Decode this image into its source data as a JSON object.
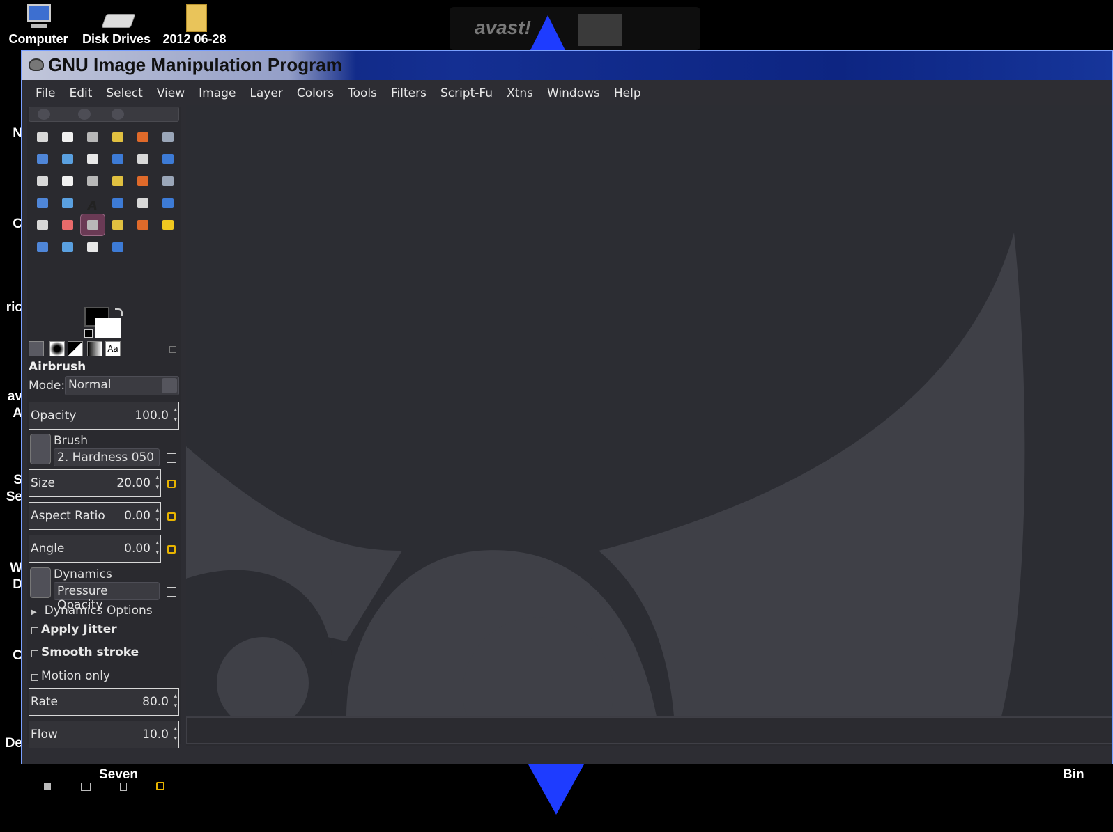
{
  "desktop": {
    "icons": [
      {
        "label": "Computer",
        "icon": "computer-icon"
      },
      {
        "label": "Disk Drives",
        "icon": "disk-drives-icon"
      },
      {
        "label": "2012 06-28",
        "icon": "folder-icon"
      }
    ],
    "bottom_labels": {
      "left": "Seven",
      "right": "Bin"
    },
    "left_clipped": [
      "N",
      "C",
      "ric",
      "av",
      "A",
      "S",
      "Se",
      "W",
      "D",
      "C",
      "De"
    ],
    "avast_text": "avast!"
  },
  "window": {
    "title": "GNU Image Manipulation Program",
    "menu": [
      "File",
      "Edit",
      "Select",
      "View",
      "Image",
      "Layer",
      "Colors",
      "Tools",
      "Filters",
      "Script-Fu",
      "Xtns",
      "Windows",
      "Help"
    ]
  },
  "toolbox": {
    "tools": [
      "rect-select-icon",
      "ellipse-select-icon",
      "free-select-icon",
      "fuzzy-select-icon",
      "select-by-color-icon",
      "scissors-select-icon",
      "foreground-select-icon",
      "paths-icon",
      "color-picker-icon",
      "zoom-icon",
      "measure-icon",
      "move-icon",
      "align-icon",
      "crop-icon",
      "rotate-icon",
      "scale-icon",
      "shear-icon",
      "perspective-icon",
      "flip-icon",
      "cage-transform-icon",
      "text-icon",
      "bucket-fill-icon",
      "blend-icon",
      "pencil-icon",
      "paintbrush-icon",
      "eraser-icon",
      "airbrush-icon",
      "ink-icon",
      "clone-icon",
      "heal-icon",
      "perspective-clone-icon",
      "blur-sharpen-icon",
      "smudge-icon",
      "dodge-burn-icon"
    ],
    "active_tool_index": 26,
    "fg_color": "#000000",
    "bg_color": "#ffffff",
    "tab_font_label": "Aa"
  },
  "options": {
    "title": "Airbrush",
    "mode_label": "Mode:",
    "mode_value": "Normal",
    "opacity": {
      "label": "Opacity",
      "value": "100.0"
    },
    "brush": {
      "label": "Brush",
      "value": "2. Hardness 050"
    },
    "size": {
      "label": "Size",
      "value": "20.00"
    },
    "aspect": {
      "label": "Aspect Ratio",
      "value": "0.00"
    },
    "angle": {
      "label": "Angle",
      "value": "0.00"
    },
    "dynamics": {
      "label": "Dynamics",
      "value": "Pressure Opacity"
    },
    "dynamics_options": "Dynamics Options",
    "apply_jitter": "Apply Jitter",
    "smooth_stroke": "Smooth stroke",
    "motion_only": "Motion only",
    "rate": {
      "label": "Rate",
      "value": "80.0"
    },
    "flow": {
      "label": "Flow",
      "value": "10.0"
    }
  },
  "colors": {
    "title_bar": "#0d2582",
    "canvas_bg": "#2c2d33",
    "wilber_shape": "#3f4047",
    "accent_arrow": "#1e3cff"
  }
}
